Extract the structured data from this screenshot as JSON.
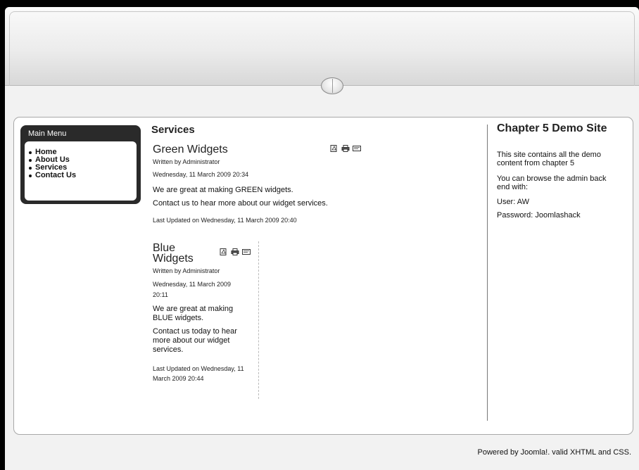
{
  "menu": {
    "title": "Main Menu",
    "items": [
      {
        "label": "Home"
      },
      {
        "label": "About Us"
      },
      {
        "label": "Services"
      },
      {
        "label": "Contact Us"
      }
    ]
  },
  "main": {
    "section_title": "Services",
    "articles": [
      {
        "title": "Green Widgets",
        "byline": "Written by Administrator",
        "date": "Wednesday, 11 March 2009 20:34",
        "paragraphs": [
          "We are great at making GREEN widgets.",
          "Contact us to hear more about our widget services."
        ],
        "updated": "Last Updated on Wednesday, 11 March 2009 20:40",
        "icons": [
          "pdf-icon",
          "print-icon",
          "email-icon"
        ]
      },
      {
        "title": "Blue Widgets",
        "byline": "Written by Administrator",
        "date": "Wednesday, 11 March 2009 20:11",
        "paragraphs": [
          "We are great at making BLUE widgets.",
          "Contact us today to hear more about our widget services."
        ],
        "updated": "Last Updated on Wednesday, 11 March 2009 20:44",
        "icons": [
          "pdf-icon",
          "print-icon",
          "email-icon"
        ]
      }
    ]
  },
  "sidebar": {
    "title": "Chapter 5 Demo Site",
    "lines": [
      "This site contains all the demo content from chapter 5",
      "You can browse the admin back end with:",
      "User: AW",
      "Password: Joomlashack"
    ]
  },
  "footer": {
    "text": "Powered by Joomla!. valid XHTML and CSS."
  }
}
